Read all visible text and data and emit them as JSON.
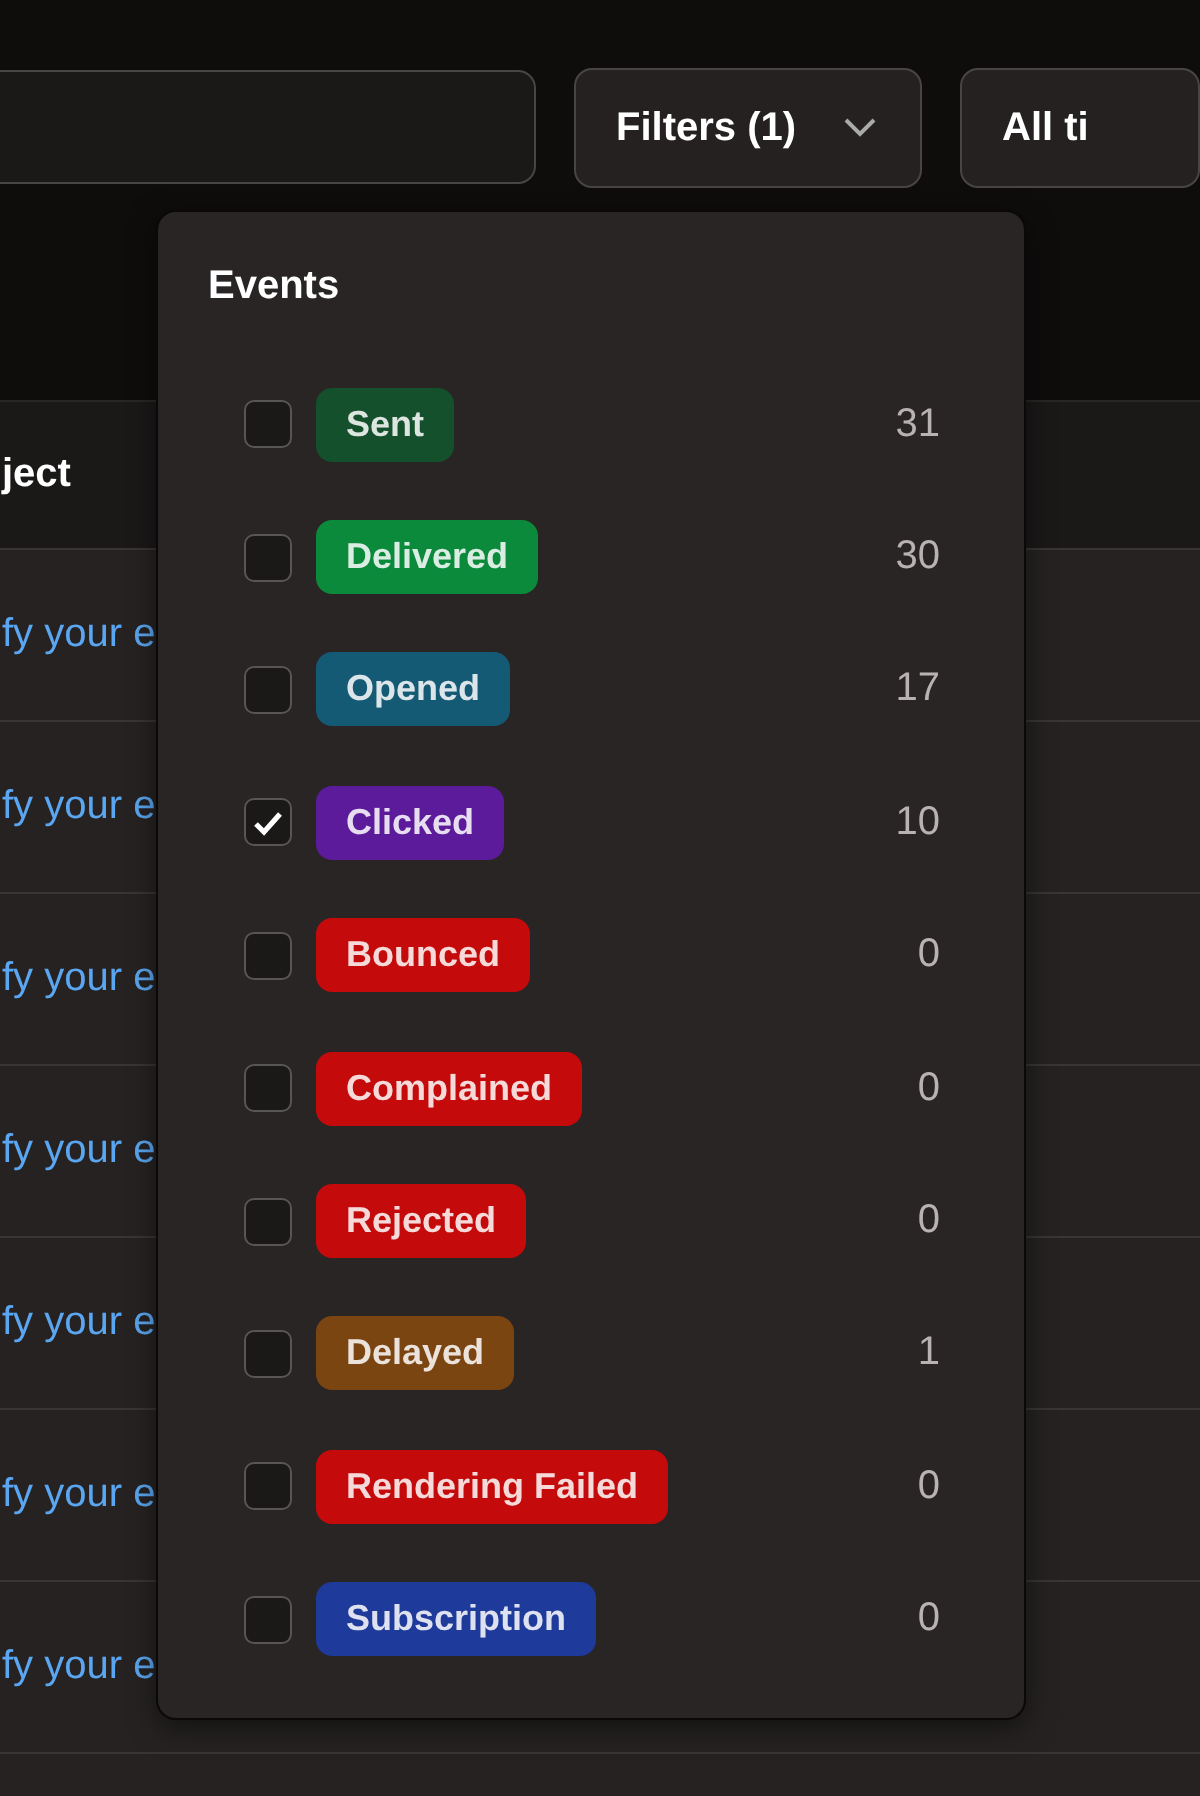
{
  "filters_button": {
    "label": "Filters (1)"
  },
  "time_button": {
    "label": "All ti"
  },
  "table": {
    "column_header": "ject",
    "rows": [
      {
        "subject": "fy your e"
      },
      {
        "subject": "fy your e"
      },
      {
        "subject": "fy your e"
      },
      {
        "subject": "fy your e"
      },
      {
        "subject": "fy your e"
      },
      {
        "subject": "fy your e"
      },
      {
        "subject": "fy your e"
      }
    ]
  },
  "dropdown": {
    "title": "Events",
    "items": [
      {
        "label": "Sent",
        "count": "31",
        "checked": false,
        "color": "#13502b"
      },
      {
        "label": "Delivered",
        "count": "30",
        "checked": false,
        "color": "#0b8a3b"
      },
      {
        "label": "Opened",
        "count": "17",
        "checked": false,
        "color": "#155a74"
      },
      {
        "label": "Clicked",
        "count": "10",
        "checked": true,
        "color": "#5c1b9a"
      },
      {
        "label": "Bounced",
        "count": "0",
        "checked": false,
        "color": "#c40a0a"
      },
      {
        "label": "Complained",
        "count": "0",
        "checked": false,
        "color": "#c40a0a"
      },
      {
        "label": "Rejected",
        "count": "0",
        "checked": false,
        "color": "#c40a0a"
      },
      {
        "label": "Delayed",
        "count": "1",
        "checked": false,
        "color": "#7a4510"
      },
      {
        "label": "Rendering Failed",
        "count": "0",
        "checked": false,
        "color": "#c40a0a"
      },
      {
        "label": "Subscription",
        "count": "0",
        "checked": false,
        "color": "#1e3a9a"
      }
    ]
  }
}
